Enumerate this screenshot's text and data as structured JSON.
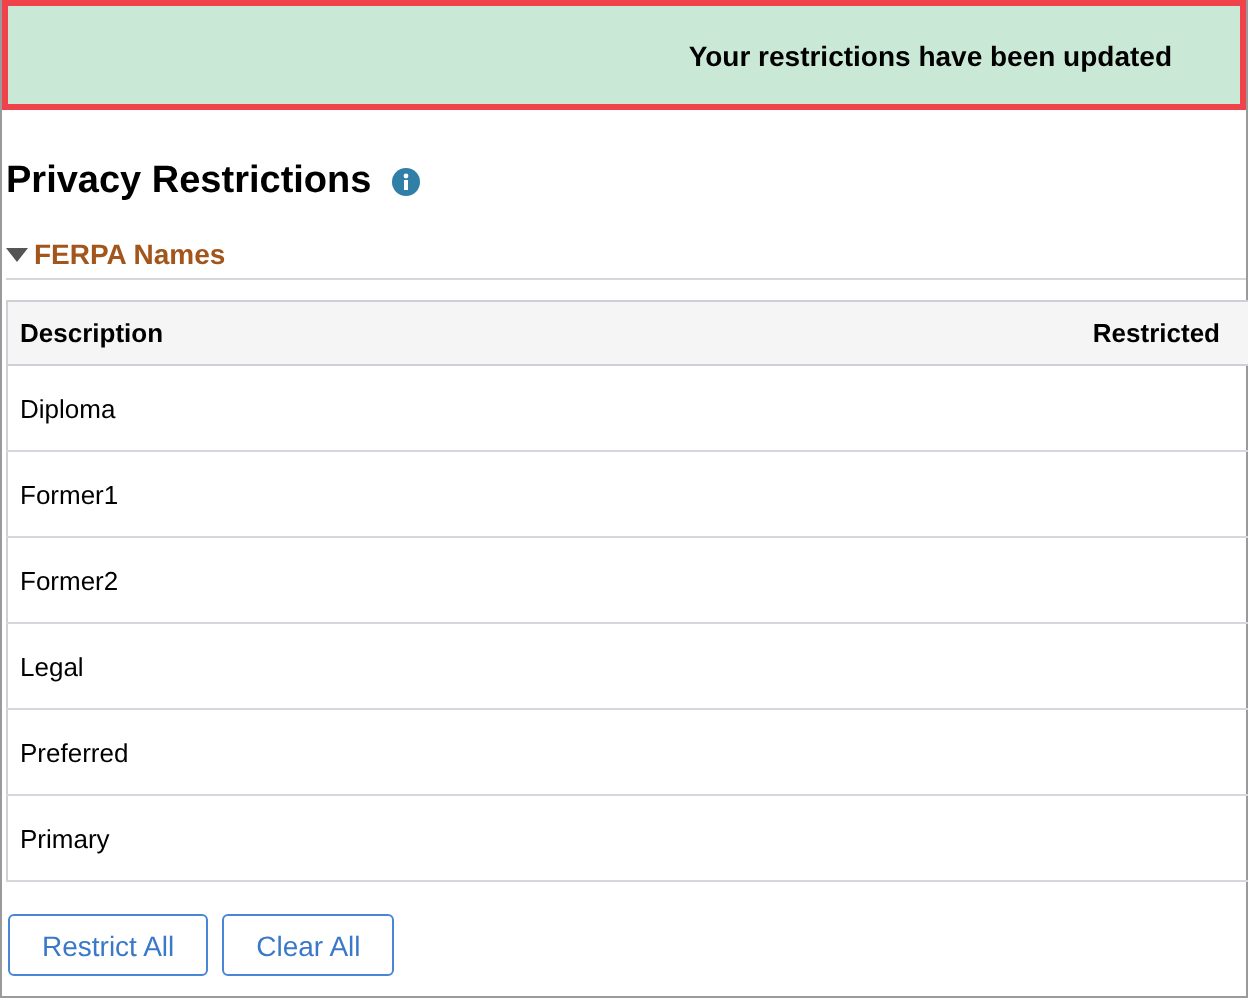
{
  "banner": {
    "message": "Your restrictions have been updated"
  },
  "page": {
    "title": "Privacy Restrictions"
  },
  "section": {
    "title": "FERPA Names",
    "expanded": true
  },
  "table": {
    "columns": [
      "Description",
      "Restricted"
    ],
    "rows": [
      {
        "description": "Diploma"
      },
      {
        "description": "Former1"
      },
      {
        "description": "Former2"
      },
      {
        "description": "Legal"
      },
      {
        "description": "Preferred"
      },
      {
        "description": "Primary"
      }
    ]
  },
  "buttons": [
    "Restrict All",
    "Clear All"
  ]
}
